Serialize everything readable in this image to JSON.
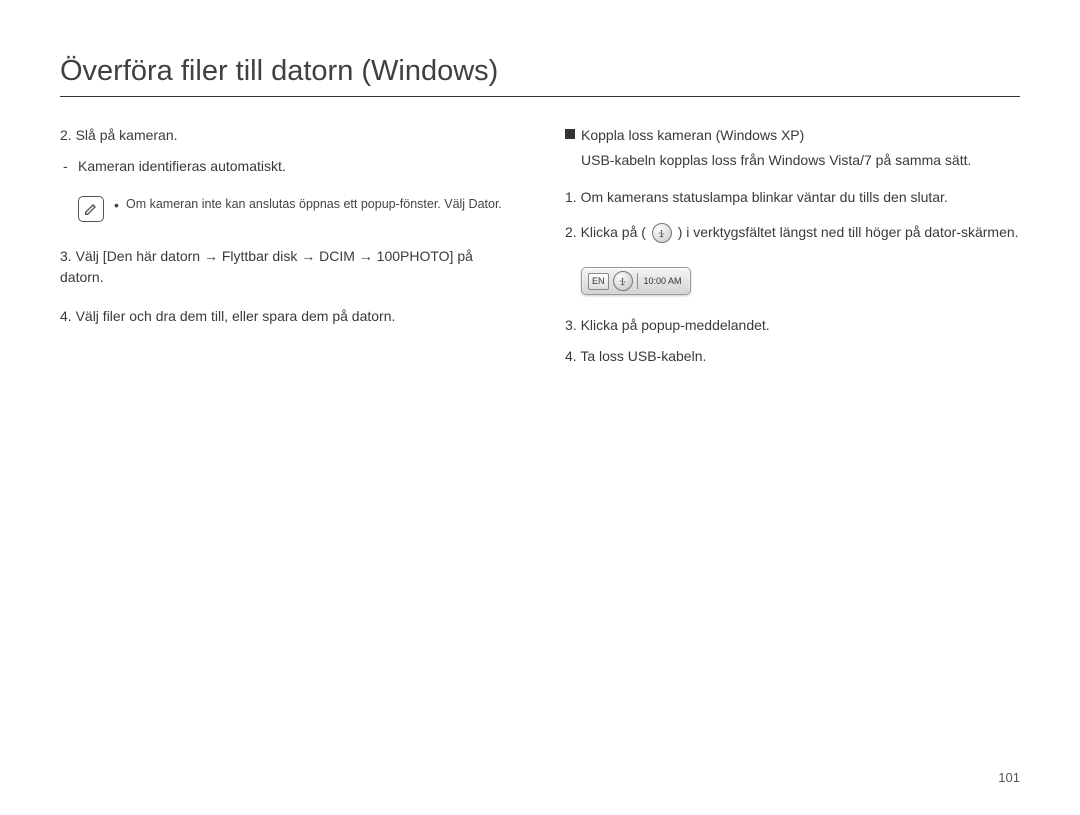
{
  "title": "Överföra filer till datorn (Windows)",
  "left": {
    "step2_main": "2. Slå på kameran.",
    "step2_sub": "Kameran identifieras automatiskt.",
    "note": "Om kameran inte kan anslutas öppnas ett popup-fönster. Välj Dator.",
    "step3": "3. Välj [Den här datorn → Flyttbar disk → DCIM → 100PHOTO] på datorn.",
    "step4": "4. Välj filer och dra dem till, eller spara dem på datorn."
  },
  "right": {
    "heading": "Koppla loss kameran (Windows XP)",
    "heading_sub": "USB-kabeln kopplas loss från Windows Vista/7 på samma sätt.",
    "step1": "1. Om kamerans statuslampa blinkar väntar du tills den slutar.",
    "step2_a": "2. Klicka på (",
    "step2_b": ") i verktygsfältet längst ned till höger på dator-skärmen.",
    "systray_lang": "EN",
    "systray_time": "10:00 AM",
    "step3": "3. Klicka på popup-meddelandet.",
    "step4": "4. Ta loss USB-kabeln."
  },
  "page_number": "101"
}
